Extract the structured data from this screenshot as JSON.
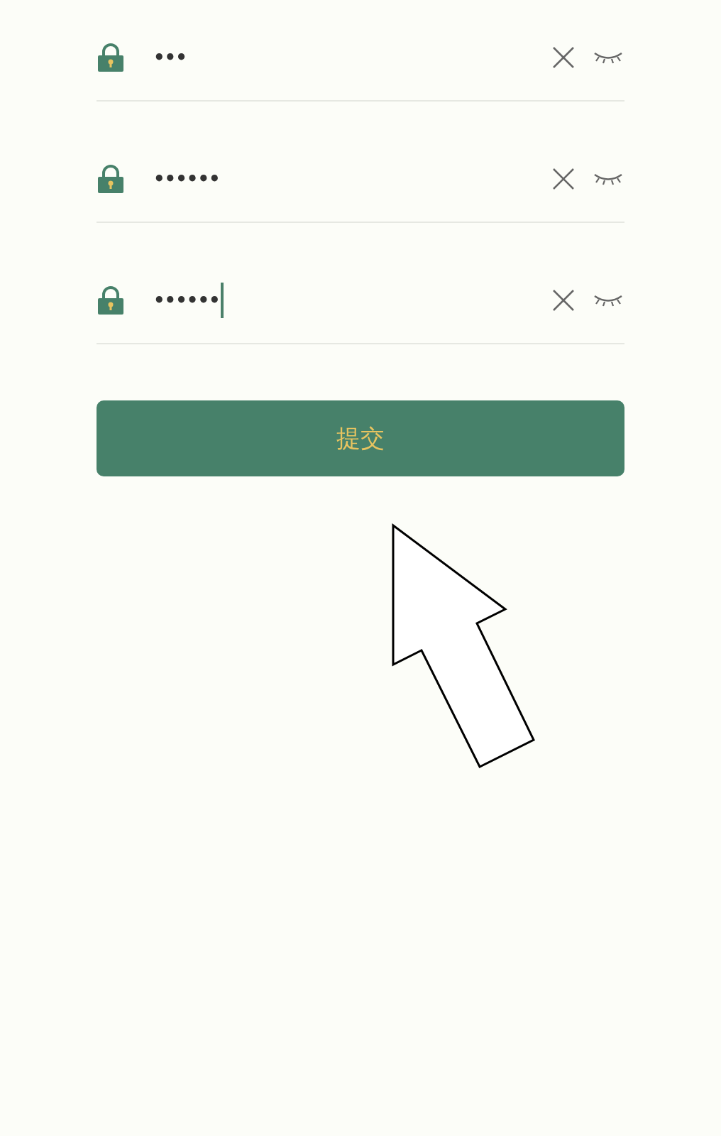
{
  "password_fields": [
    {
      "value": "•••",
      "focused": false
    },
    {
      "value": "••••••",
      "focused": false
    },
    {
      "value": "••••••",
      "focused": true
    }
  ],
  "submit_button": {
    "label": "提交"
  }
}
